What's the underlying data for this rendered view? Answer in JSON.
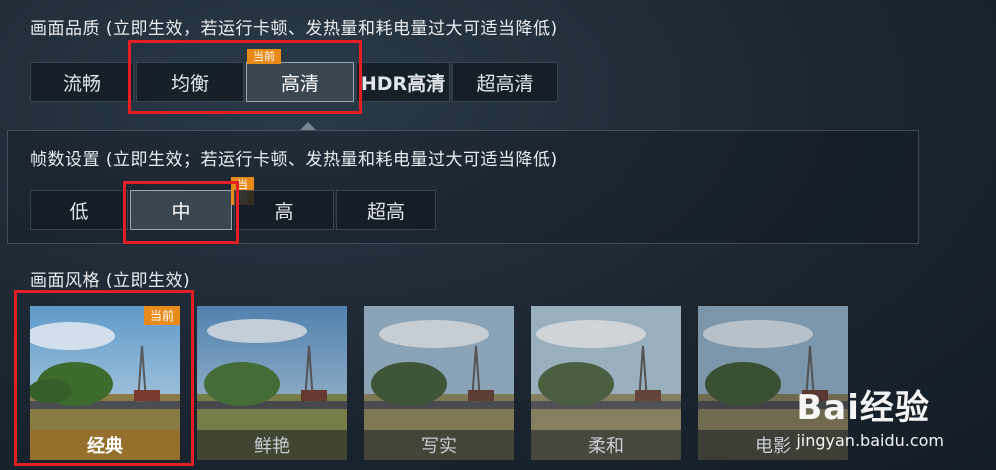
{
  "quality": {
    "title": "画面品质 (立即生效，若运行卡顿、发热量和耗电量过大可适当降低)",
    "badge": "当前",
    "options": [
      "流畅",
      "均衡",
      "高清",
      "HDR高清",
      "超高清"
    ]
  },
  "fps": {
    "title": "帧数设置 (立即生效；若运行卡顿、发热量和耗电量过大可适当降低)",
    "badge": "当前",
    "options": [
      "低",
      "中",
      "高",
      "超高"
    ]
  },
  "style": {
    "title": "画面风格 (立即生效)",
    "badge": "当前",
    "options": [
      "经典",
      "鲜艳",
      "写实",
      "柔和",
      "电影"
    ]
  },
  "watermark": {
    "logo": "Bai经验",
    "url": "jingyan.baidu.com"
  },
  "colors": {
    "highlight_box": "#e31e24",
    "badge": "#e88a1a"
  }
}
